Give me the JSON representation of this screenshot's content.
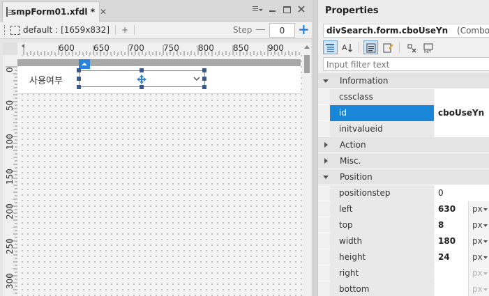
{
  "editor": {
    "tab_title": "smpForm01.xfdl *",
    "tab_close": "✕",
    "layout_label": "default :",
    "layout_size": "[1659x832]",
    "add_layout": "+",
    "step_label": "Step",
    "step_value": "0"
  },
  "rulers": {
    "horizontal": [
      "600",
      "650",
      "700",
      "750",
      "800",
      "850",
      "900"
    ],
    "vertical": [
      "0",
      "50",
      "100",
      "150",
      "200",
      "250",
      "300"
    ]
  },
  "form": {
    "label_text": "사용여부"
  },
  "properties": {
    "header": "Properties",
    "target_object": "divSearch.form.cboUseYn",
    "target_type": "(Combo)",
    "filter_placeholder": "Input filter text",
    "categories": [
      {
        "name": "Information",
        "expanded": true,
        "props": [
          {
            "name": "cssclass",
            "value": ""
          },
          {
            "name": "id",
            "value": "cboUseYn",
            "selected": true
          },
          {
            "name": "initvalueid",
            "value": ""
          }
        ]
      },
      {
        "name": "Action",
        "expanded": false,
        "props": []
      },
      {
        "name": "Misc.",
        "expanded": false,
        "props": []
      },
      {
        "name": "Position",
        "expanded": true,
        "props": [
          {
            "name": "positionstep",
            "value": "0"
          },
          {
            "name": "left",
            "value": "630",
            "unit": "px"
          },
          {
            "name": "top",
            "value": "8",
            "unit": "px"
          },
          {
            "name": "width",
            "value": "180",
            "unit": "px"
          },
          {
            "name": "height",
            "value": "24",
            "unit": "px"
          },
          {
            "name": "right",
            "value": "",
            "unit": "px",
            "disabled": true
          },
          {
            "name": "bottom",
            "value": "",
            "unit": "px",
            "disabled": true
          }
        ]
      }
    ]
  },
  "colors": {
    "accent": "#1a86d8",
    "handle": "#3a5a8c"
  }
}
